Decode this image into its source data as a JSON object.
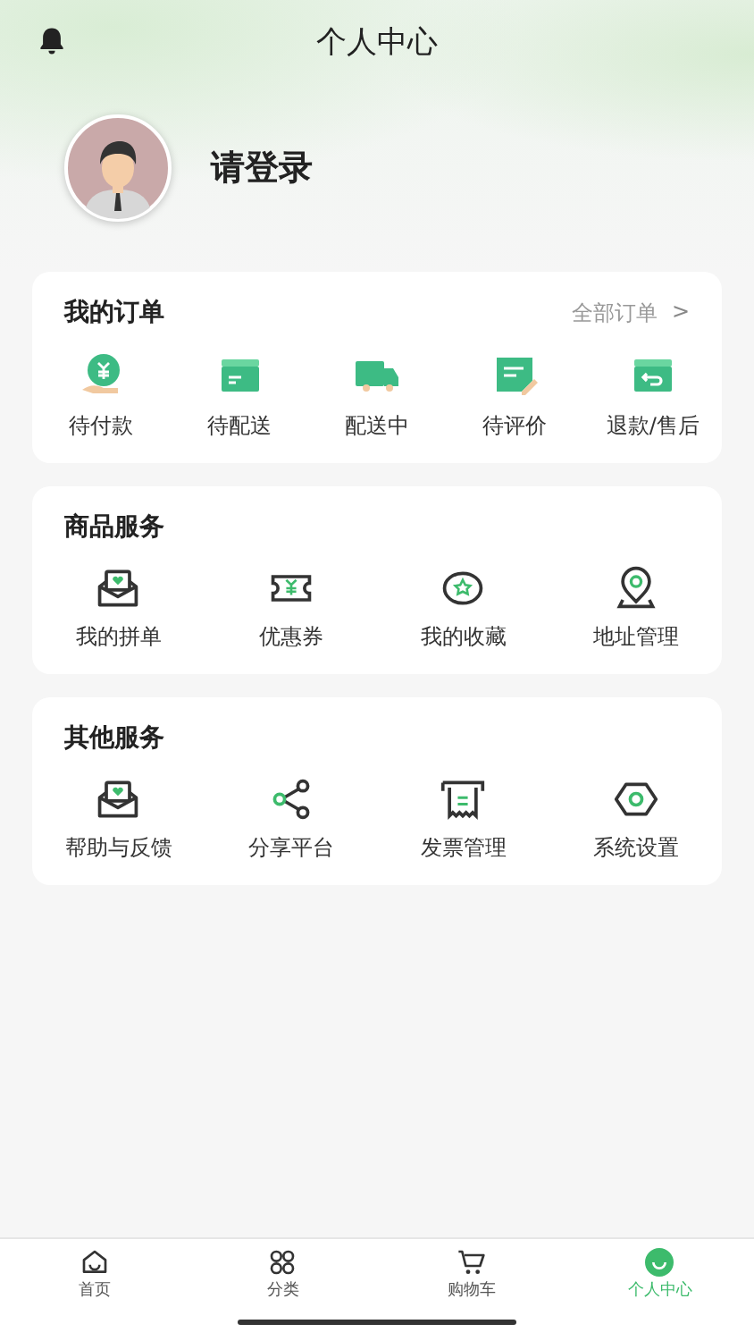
{
  "header": {
    "title": "个人中心"
  },
  "profile": {
    "login_text": "请登录"
  },
  "orders": {
    "title": "我的订单",
    "all_link": "全部订单",
    "chevron": ">",
    "items": [
      {
        "label": "待付款"
      },
      {
        "label": "待配送"
      },
      {
        "label": "配送中"
      },
      {
        "label": "待评价"
      },
      {
        "label": "退款/售后"
      }
    ]
  },
  "goods_services": {
    "title": "商品服务",
    "items": [
      {
        "label": "我的拼单"
      },
      {
        "label": "优惠券"
      },
      {
        "label": "我的收藏"
      },
      {
        "label": "地址管理"
      }
    ]
  },
  "other_services": {
    "title": "其他服务",
    "items": [
      {
        "label": "帮助与反馈"
      },
      {
        "label": "分享平台"
      },
      {
        "label": "发票管理"
      },
      {
        "label": "系统设置"
      }
    ]
  },
  "tab_bar": [
    {
      "label": "首页",
      "selected": false
    },
    {
      "label": "分类",
      "selected": false
    },
    {
      "label": "购物车",
      "selected": false
    },
    {
      "label": "个人中心",
      "selected": true
    }
  ]
}
